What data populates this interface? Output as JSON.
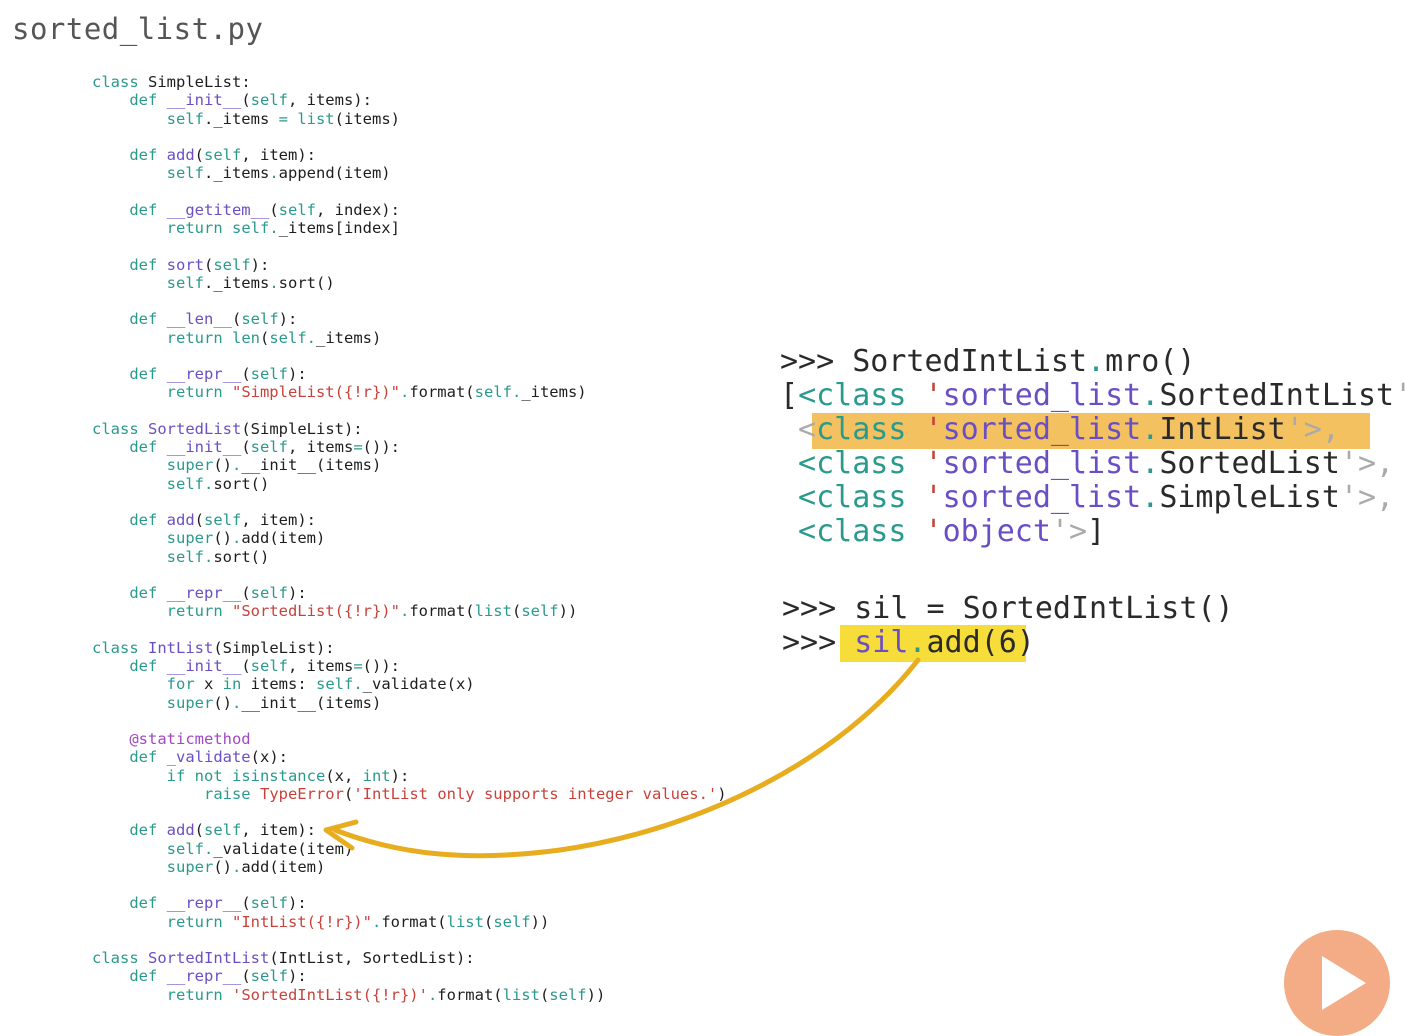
{
  "file": {
    "name": "sorted_list.py"
  },
  "code": {
    "lines": [
      [
        [
          "kw",
          "class "
        ],
        [
          "",
          "SimpleList:"
        ]
      ],
      [
        [
          "kw",
          "    def "
        ],
        [
          "fn",
          "__init__"
        ],
        [
          "",
          "("
        ],
        [
          "self",
          "self"
        ],
        [
          "",
          ", items):"
        ]
      ],
      [
        [
          "self",
          "        self"
        ],
        [
          "",
          "._items "
        ],
        [
          "op",
          "="
        ],
        [
          "bi",
          " list"
        ],
        [
          "",
          "(items)"
        ]
      ],
      [
        [
          "",
          ""
        ]
      ],
      [
        [
          "kw",
          "    def "
        ],
        [
          "fn",
          "add"
        ],
        [
          "",
          "("
        ],
        [
          "self",
          "self"
        ],
        [
          "",
          ", item):"
        ]
      ],
      [
        [
          "self",
          "        self"
        ],
        [
          "",
          "._items"
        ],
        [
          "op",
          "."
        ],
        [
          "",
          "append(item)"
        ]
      ],
      [
        [
          "",
          ""
        ]
      ],
      [
        [
          "kw",
          "    def "
        ],
        [
          "fn",
          "__getitem__"
        ],
        [
          "",
          "("
        ],
        [
          "self",
          "self"
        ],
        [
          "",
          ", index):"
        ]
      ],
      [
        [
          "kw",
          "        return "
        ],
        [
          "self",
          "self"
        ],
        [
          "op",
          "."
        ],
        [
          "",
          "_items[index]"
        ]
      ],
      [
        [
          "",
          ""
        ]
      ],
      [
        [
          "kw",
          "    def "
        ],
        [
          "fn",
          "sort"
        ],
        [
          "",
          "("
        ],
        [
          "self",
          "self"
        ],
        [
          "",
          "):"
        ]
      ],
      [
        [
          "self",
          "        self"
        ],
        [
          "",
          "._items"
        ],
        [
          "op",
          "."
        ],
        [
          "",
          "sort()"
        ]
      ],
      [
        [
          "",
          ""
        ]
      ],
      [
        [
          "kw",
          "    def "
        ],
        [
          "fn",
          "__len__"
        ],
        [
          "",
          "("
        ],
        [
          "self",
          "self"
        ],
        [
          "",
          "):"
        ]
      ],
      [
        [
          "kw",
          "        return "
        ],
        [
          "bi",
          "len"
        ],
        [
          "",
          "("
        ],
        [
          "self",
          "self"
        ],
        [
          "op",
          "."
        ],
        [
          "",
          "_items)"
        ]
      ],
      [
        [
          "",
          ""
        ]
      ],
      [
        [
          "kw",
          "    def "
        ],
        [
          "fn",
          "__repr__"
        ],
        [
          "",
          "("
        ],
        [
          "self",
          "self"
        ],
        [
          "",
          "):"
        ]
      ],
      [
        [
          "kw",
          "        return "
        ],
        [
          "str",
          "\"SimpleList({!r})\""
        ],
        [
          "op",
          "."
        ],
        [
          "",
          "format("
        ],
        [
          "self",
          "self"
        ],
        [
          "op",
          "."
        ],
        [
          "",
          "_items)"
        ]
      ],
      [
        [
          "",
          ""
        ]
      ],
      [
        [
          "kw",
          "class "
        ],
        [
          "cls",
          "SortedList"
        ],
        [
          "",
          "(SimpleList):"
        ]
      ],
      [
        [
          "kw",
          "    def "
        ],
        [
          "fn",
          "__init__"
        ],
        [
          "",
          "("
        ],
        [
          "self",
          "self"
        ],
        [
          "",
          ", items"
        ],
        [
          "op",
          "="
        ],
        [
          "",
          "()):"
        ]
      ],
      [
        [
          "bi",
          "        super"
        ],
        [
          "",
          "()"
        ],
        [
          "op",
          "."
        ],
        [
          "",
          "__init__(items)"
        ]
      ],
      [
        [
          "self",
          "        self"
        ],
        [
          "op",
          "."
        ],
        [
          "",
          "sort()"
        ]
      ],
      [
        [
          "",
          ""
        ]
      ],
      [
        [
          "kw",
          "    def "
        ],
        [
          "fn",
          "add"
        ],
        [
          "",
          "("
        ],
        [
          "self",
          "self"
        ],
        [
          "",
          ", item):"
        ]
      ],
      [
        [
          "bi",
          "        super"
        ],
        [
          "",
          "()"
        ],
        [
          "op",
          "."
        ],
        [
          "",
          "add(item)"
        ]
      ],
      [
        [
          "self",
          "        self"
        ],
        [
          "op",
          "."
        ],
        [
          "",
          "sort()"
        ]
      ],
      [
        [
          "",
          ""
        ]
      ],
      [
        [
          "kw",
          "    def "
        ],
        [
          "fn",
          "__repr__"
        ],
        [
          "",
          "("
        ],
        [
          "self",
          "self"
        ],
        [
          "",
          "):"
        ]
      ],
      [
        [
          "kw",
          "        return "
        ],
        [
          "str",
          "\"SortedList({!r})\""
        ],
        [
          "op",
          "."
        ],
        [
          "",
          "format("
        ],
        [
          "bi",
          "list"
        ],
        [
          "",
          "("
        ],
        [
          "self",
          "self"
        ],
        [
          "",
          "))"
        ]
      ],
      [
        [
          "",
          ""
        ]
      ],
      [
        [
          "kw",
          "class "
        ],
        [
          "cls",
          "IntList"
        ],
        [
          "",
          "(SimpleList):"
        ]
      ],
      [
        [
          "kw",
          "    def "
        ],
        [
          "fn",
          "__init__"
        ],
        [
          "",
          "("
        ],
        [
          "self",
          "self"
        ],
        [
          "",
          ", items"
        ],
        [
          "op",
          "="
        ],
        [
          "",
          "()):"
        ]
      ],
      [
        [
          "kw",
          "        for "
        ],
        [
          "",
          "x "
        ],
        [
          "kw",
          "in "
        ],
        [
          "",
          "items: "
        ],
        [
          "self",
          "self"
        ],
        [
          "op",
          "."
        ],
        [
          "",
          "_validate(x)"
        ]
      ],
      [
        [
          "bi",
          "        super"
        ],
        [
          "",
          "()"
        ],
        [
          "op",
          "."
        ],
        [
          "",
          "__init__(items)"
        ]
      ],
      [
        [
          "",
          ""
        ]
      ],
      [
        [
          "dec",
          "    @staticmethod"
        ]
      ],
      [
        [
          "kw",
          "    def "
        ],
        [
          "fn",
          "_validate"
        ],
        [
          "",
          "(x):"
        ]
      ],
      [
        [
          "kw",
          "        if "
        ],
        [
          "kw",
          "not "
        ],
        [
          "bi",
          "isinstance"
        ],
        [
          "",
          "(x, "
        ],
        [
          "bi",
          "int"
        ],
        [
          "",
          "):"
        ]
      ],
      [
        [
          "kw",
          "            raise "
        ],
        [
          "str",
          "TypeError"
        ],
        [
          "",
          "("
        ],
        [
          "str",
          "'IntList only supports integer values.'"
        ],
        [
          "",
          ")"
        ]
      ],
      [
        [
          "",
          ""
        ]
      ],
      [
        [
          "kw",
          "    def "
        ],
        [
          "fn",
          "add"
        ],
        [
          "",
          "("
        ],
        [
          "self",
          "self"
        ],
        [
          "",
          ", item):"
        ]
      ],
      [
        [
          "self",
          "        self"
        ],
        [
          "op",
          "."
        ],
        [
          "",
          "_validate(item)"
        ]
      ],
      [
        [
          "bi",
          "        super"
        ],
        [
          "",
          "()"
        ],
        [
          "op",
          "."
        ],
        [
          "",
          "add(item)"
        ]
      ],
      [
        [
          "",
          ""
        ]
      ],
      [
        [
          "kw",
          "    def "
        ],
        [
          "fn",
          "__repr__"
        ],
        [
          "",
          "("
        ],
        [
          "self",
          "self"
        ],
        [
          "",
          "):"
        ]
      ],
      [
        [
          "kw",
          "        return "
        ],
        [
          "str",
          "\"IntList({!r})\""
        ],
        [
          "op",
          "."
        ],
        [
          "",
          "format("
        ],
        [
          "bi",
          "list"
        ],
        [
          "",
          "("
        ],
        [
          "self",
          "self"
        ],
        [
          "",
          "))"
        ]
      ],
      [
        [
          "",
          ""
        ]
      ],
      [
        [
          "kw",
          "class "
        ],
        [
          "cls",
          "SortedIntList"
        ],
        [
          "",
          "(IntList, SortedList):"
        ]
      ],
      [
        [
          "kw",
          "    def "
        ],
        [
          "fn",
          "__repr__"
        ],
        [
          "",
          "("
        ],
        [
          "self",
          "self"
        ],
        [
          "",
          "):"
        ]
      ],
      [
        [
          "kw",
          "        return "
        ],
        [
          "str",
          "'SortedIntList({!r})'"
        ],
        [
          "op",
          "."
        ],
        [
          "",
          "format("
        ],
        [
          "bi",
          "list"
        ],
        [
          "",
          "("
        ],
        [
          "self",
          "self"
        ],
        [
          "",
          "))"
        ]
      ]
    ]
  },
  "repl": {
    "mro_lines": [
      [
        [
          "",
          ">>> SortedIntList"
        ],
        [
          "r-dot",
          "."
        ],
        [
          "",
          "mro()"
        ]
      ],
      [
        [
          "",
          "["
        ],
        [
          "r-kw",
          "<class "
        ],
        [
          "r-q",
          "'"
        ],
        [
          "r-mod",
          "sorted_list"
        ],
        [
          "r-dot",
          "."
        ],
        [
          "",
          "SortedIntList"
        ],
        [
          "r-dim",
          "'>,"
        ]
      ],
      [
        [
          "r-dim",
          " <"
        ],
        [
          "r-kw",
          "class "
        ],
        [
          "r-q",
          "'"
        ],
        [
          "r-mod",
          "sorted_list"
        ],
        [
          "r-dot",
          "."
        ],
        [
          "",
          "IntList"
        ],
        [
          "r-dim",
          "'>,"
        ]
      ],
      [
        [
          "",
          ""
        ],
        [
          "r-kw",
          " <class "
        ],
        [
          "r-q",
          "'"
        ],
        [
          "r-mod",
          "sorted_list"
        ],
        [
          "r-dot",
          "."
        ],
        [
          "",
          "SortedList"
        ],
        [
          "r-dim",
          "'>,"
        ]
      ],
      [
        [
          "",
          ""
        ],
        [
          "r-kw",
          " <class "
        ],
        [
          "r-q",
          "'"
        ],
        [
          "r-mod",
          "sorted_list"
        ],
        [
          "r-dot",
          "."
        ],
        [
          "",
          "SimpleList"
        ],
        [
          "r-dim",
          "'>,"
        ]
      ],
      [
        [
          "",
          ""
        ],
        [
          "r-kw",
          " <class "
        ],
        [
          "r-q",
          "'"
        ],
        [
          "r-mod",
          "object"
        ],
        [
          "r-dim",
          "'>"
        ],
        [
          "",
          "]"
        ]
      ]
    ],
    "sil_lines": [
      [
        [
          "",
          ">>> sil = SortedIntList()"
        ]
      ],
      [
        [
          "",
          ">>> "
        ],
        [
          "r-mod",
          "sil"
        ],
        [
          "r-dot",
          "."
        ],
        [
          "",
          "add(6)"
        ]
      ]
    ]
  },
  "colors": {
    "highlight_orange": "#f4c160",
    "highlight_yellow": "#f7dd3a",
    "arrow": "#e8ad1e",
    "play_button": "#f2a478"
  },
  "icons": {
    "play": "play-icon",
    "arrow": "curved-arrow-icon"
  }
}
